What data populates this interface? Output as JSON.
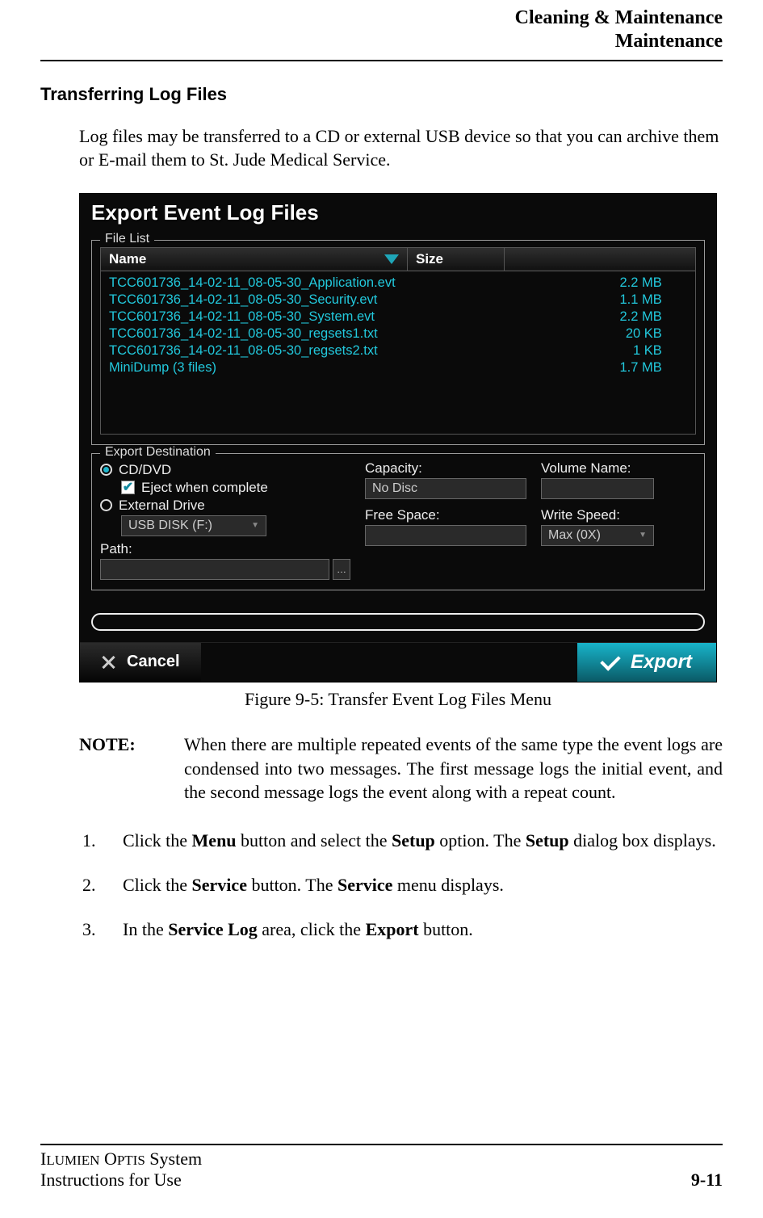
{
  "header": {
    "line1": "Cleaning & Maintenance",
    "line2": "Maintenance"
  },
  "section_title": "Transferring Log Files",
  "intro": "Log files may be transferred to a CD or external USB device so that you can archive them or E-mail them to St. Jude Medical Service.",
  "dialog": {
    "title": "Export Event Log Files",
    "file_list_legend": "File List",
    "col_name": "Name",
    "col_size": "Size",
    "rows": [
      {
        "name": "TCC601736_14-02-11_08-05-30_Application.evt",
        "size": "2.2 MB"
      },
      {
        "name": "TCC601736_14-02-11_08-05-30_Security.evt",
        "size": "1.1 MB"
      },
      {
        "name": "TCC601736_14-02-11_08-05-30_System.evt",
        "size": "2.2 MB"
      },
      {
        "name": "TCC601736_14-02-11_08-05-30_regsets1.txt",
        "size": "20 KB"
      },
      {
        "name": "TCC601736_14-02-11_08-05-30_regsets2.txt",
        "size": "1 KB"
      },
      {
        "name": "MiniDump (3 files)",
        "size": "1.7 MB"
      }
    ],
    "dest_legend": "Export Destination",
    "radio_cd": "CD/DVD",
    "eject_label": "Eject when complete",
    "radio_ext": "External Drive",
    "ext_drive_value": "USB DISK (F:)",
    "path_label": "Path:",
    "capacity_label": "Capacity:",
    "capacity_value": "No Disc",
    "free_label": "Free Space:",
    "free_value": "",
    "volume_label": "Volume Name:",
    "volume_value": "",
    "speed_label": "Write Speed:",
    "speed_value": "Max (0X)",
    "cancel": "Cancel",
    "export": "Export"
  },
  "caption": "Figure 9-5:  Transfer Event Log Files Menu",
  "note": {
    "label": "NOTE:",
    "text": "When there are multiple repeated events of the same type the event logs are condensed into two messages. The first message logs the initial event, and the second message logs the event along with a repeat count."
  },
  "steps": {
    "s1_a": "Click the ",
    "s1_b": "Menu",
    "s1_c": " button and select the ",
    "s1_d": "Setup",
    "s1_e": " option. The ",
    "s1_f": "Setup",
    "s1_g": " dialog box displays.",
    "s2_a": "Click the ",
    "s2_b": "Service",
    "s2_c": " button. The ",
    "s2_d": "Service",
    "s2_e": " menu displays.",
    "s3_a": "In the ",
    "s3_b": "Service Log",
    "s3_c": " area, click  the ",
    "s3_d": "Export",
    "s3_e": " button."
  },
  "footer": {
    "system_l1_a": "I",
    "system_l1_b": "LUMIEN",
    "system_l1_c": " O",
    "system_l1_d": "PTIS",
    "system_l1_e": " System",
    "system_l2": "Instructions for Use",
    "page": "9-11"
  }
}
